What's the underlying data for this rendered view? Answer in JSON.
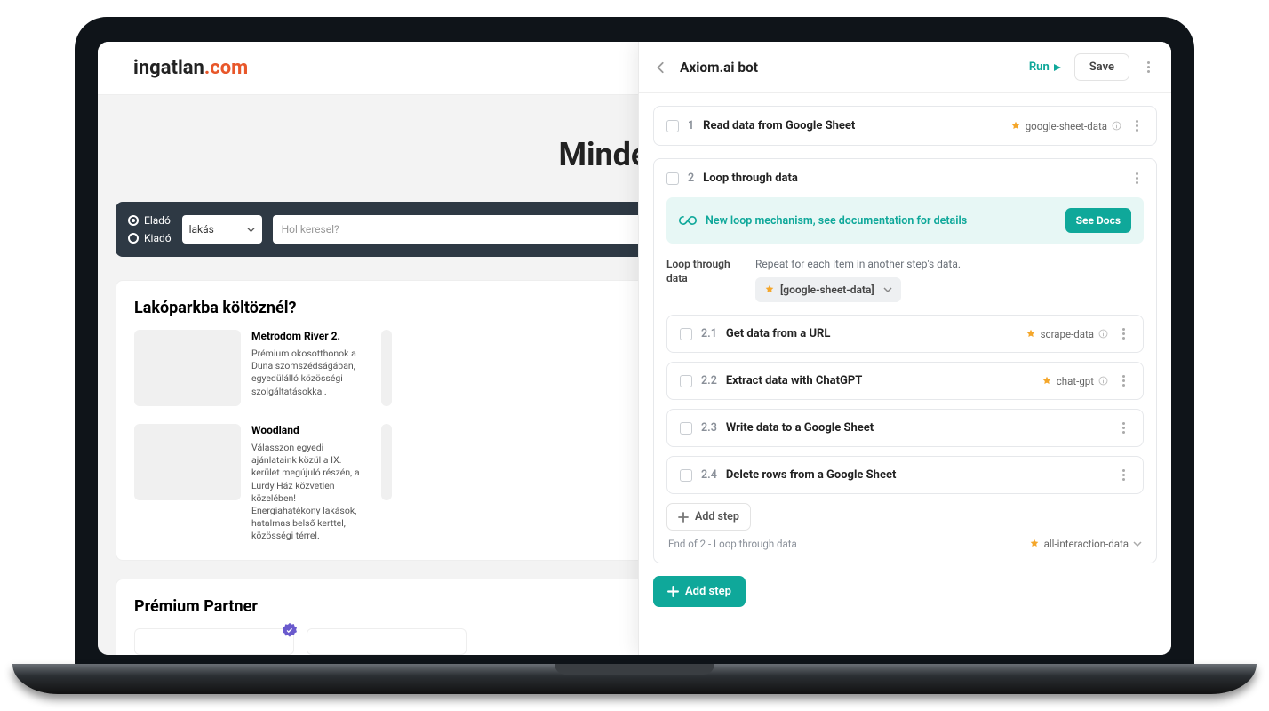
{
  "web": {
    "logo_left": "ingatlan",
    "logo_right": ".com",
    "hero_title": "Mindenhol",
    "radio_sale": "Eladó",
    "radio_rent": "Kiadó",
    "select_value": "lakás",
    "search_placeholder": "Hol keresel?",
    "section1_title": "Lakóparkba költöznél?",
    "cards": [
      {
        "title": "Metrodom River 2.",
        "desc": "Prémium okosotthonok a Duna szomszédságában, egyedülálló közösségi szolgáltatásokkal."
      },
      {
        "title": "Woodland",
        "desc": "Válasszon egyedi ajánlataink közül a IX. kerület megújuló részén, a Lurdy Ház közvetlen közelében! Energiahatékony lakások, hatalmas belső kerttel, közösségi térrel."
      }
    ],
    "section2_title": "Prémium Partner"
  },
  "panel": {
    "title": "Axiom.ai bot",
    "run_label": "Run",
    "save_label": "Save",
    "notice_text": "New loop mechanism, see documentation for details",
    "see_docs": "See Docs",
    "param_label": "Loop through data",
    "param_hint": "Repeat for each item in another step's data.",
    "param_token": "[google-sheet-data]",
    "add_step": "Add step",
    "end_text": "End of 2 - Loop through data",
    "end_token": "all-interaction-data",
    "steps": [
      {
        "num": "1",
        "title": "Read data from Google Sheet",
        "tag": "google-sheet-data"
      },
      {
        "num": "2",
        "title": "Loop through data",
        "tag": ""
      }
    ],
    "substeps": [
      {
        "num": "2.1",
        "title": "Get data from a URL",
        "tag": "scrape-data"
      },
      {
        "num": "2.2",
        "title": "Extract data with ChatGPT",
        "tag": "chat-gpt"
      },
      {
        "num": "2.3",
        "title": "Write data to a Google Sheet",
        "tag": ""
      },
      {
        "num": "2.4",
        "title": "Delete rows from a Google Sheet",
        "tag": ""
      }
    ]
  }
}
